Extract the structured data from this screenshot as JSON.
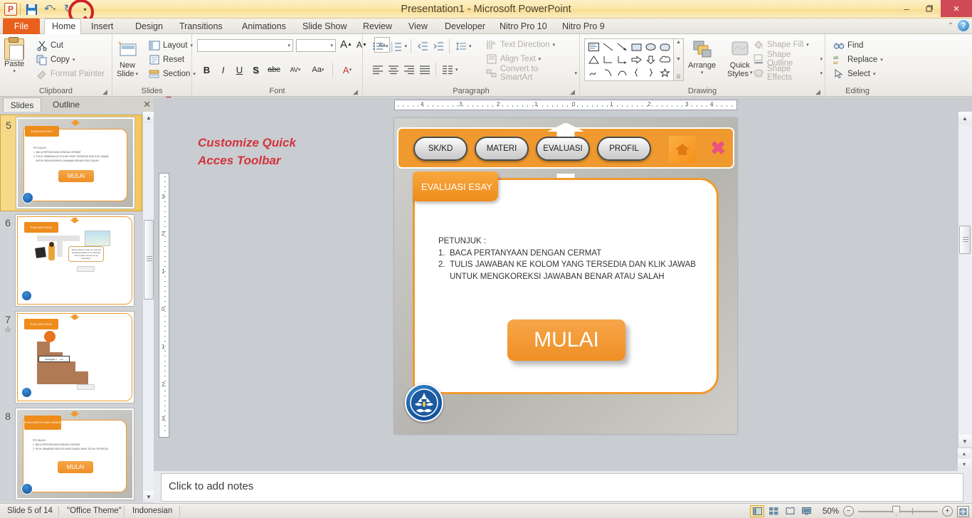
{
  "window": {
    "title": "Presentation1  -  Microsoft PowerPoint",
    "minimize": "–",
    "restore": "❐",
    "close": "×",
    "help": "?",
    "collapse_ribbon": "⌃"
  },
  "qat": {
    "app_icon": "P",
    "save": "save-icon",
    "undo": "↶",
    "redo": "↻",
    "customize": "▾"
  },
  "tabs": [
    {
      "label": "File",
      "state": "file"
    },
    {
      "label": "Home",
      "state": "active"
    },
    {
      "label": "Insert",
      "state": "normal"
    },
    {
      "label": "Design",
      "state": "normal"
    },
    {
      "label": "Transitions",
      "state": "normal"
    },
    {
      "label": "Animations",
      "state": "normal"
    },
    {
      "label": "Slide Show",
      "state": "normal"
    },
    {
      "label": "Review",
      "state": "normal"
    },
    {
      "label": "View",
      "state": "normal"
    },
    {
      "label": "Developer",
      "state": "normal"
    },
    {
      "label": "Nitro Pro 10",
      "state": "normal"
    },
    {
      "label": "Nitro Pro 9",
      "state": "normal"
    }
  ],
  "ribbon": {
    "clipboard": {
      "label": "Clipboard",
      "paste": "Paste",
      "cut": "Cut",
      "copy": "Copy",
      "format_painter": "Format Painter"
    },
    "slides": {
      "label": "Slides",
      "new_slide": "New\nSlide",
      "new_slide_line1": "New",
      "new_slide_line2": "Slide",
      "layout": "Layout",
      "reset": "Reset",
      "section": "Section"
    },
    "font": {
      "label": "Font",
      "font_name": "",
      "font_size": "",
      "grow_font": "A",
      "shrink_font": "A",
      "clear_formatting": "Aa",
      "bold": "B",
      "italic": "I",
      "underline": "U",
      "shadow": "S",
      "strikethrough": "abc",
      "char_spacing": "AV",
      "change_case": "Aa",
      "font_color": "A"
    },
    "paragraph": {
      "label": "Paragraph",
      "text_direction": "Text Direction",
      "align_text": "Align Text",
      "convert_smartart": "Convert to SmartArt"
    },
    "drawing": {
      "label": "Drawing",
      "arrange": "Arrange",
      "quick_styles_line1": "Quick",
      "quick_styles_line2": "Styles",
      "shape_fill": "Shape Fill",
      "shape_outline": "Shape Outline",
      "shape_effects": "Shape Effects"
    },
    "editing": {
      "label": "Editing",
      "find": "Find",
      "replace": "Replace",
      "select": "Select"
    }
  },
  "pane": {
    "tab_slides": "Slides",
    "tab_outline": "Outline",
    "close": "✕",
    "thumbnails": [
      {
        "number": "5",
        "selected": true,
        "kind": "esay",
        "tag": "EVALUASI ESAY",
        "button": "MULAI"
      },
      {
        "number": "6",
        "selected": false,
        "kind": "question",
        "tag": "EVALUASI ESAY",
        "button": "JAWAB"
      },
      {
        "number": "7",
        "selected": false,
        "kind": "stairs",
        "tag": "EVALUASI ESAY",
        "button": "JAWAB",
        "starred": true
      },
      {
        "number": "8",
        "selected": false,
        "kind": "pilgan",
        "tag": "EVALUASI PILIHAN GANDA",
        "button": "MULAI"
      }
    ]
  },
  "annotation": {
    "line1": "Customize Quick",
    "line2": "Acces Toolbar",
    "color": "#d2333c"
  },
  "ruler": {
    "horizontal": [
      "4",
      "3",
      "2",
      "1",
      "0",
      "1",
      "2",
      "3",
      "4"
    ],
    "vertical": [
      "3",
      "2",
      "1",
      "0",
      "1",
      "2",
      "3"
    ]
  },
  "slide": {
    "nav_buttons": [
      "SK/KD",
      "MATERI",
      "EVALUASI",
      "PROFIL"
    ],
    "home_icon": "home-icon",
    "close_icon": "✖",
    "title_tag": "EVALUASI ESAY",
    "instructions_heading": "PETUNJUK  :",
    "instructions": [
      {
        "num": "1.",
        "text": "BACA  PERTANYAAN   DENGAN  CERMAT"
      },
      {
        "num": "2.",
        "text": "TULIS JAWABAN  KE KOLOM YANG  TERSEDIA  DAN  KLIK JAWAB"
      },
      {
        "num": "",
        "text": "UNTUK  MENGKOREKSI  JAWABAN   BENAR  ATAU  SALAH"
      }
    ],
    "start_button": "MULAI",
    "logo": "kemdikbud-logo",
    "accent_color": "#f0992e"
  },
  "notes": {
    "placeholder": "Click to add notes"
  },
  "status": {
    "slide_counter": "Slide 5 of 14",
    "theme": "\"Office Theme\"",
    "language": "Indonesian",
    "zoom": "50%",
    "views": [
      "normal-view",
      "slide-sorter-view",
      "reading-view",
      "slide-show-view"
    ],
    "zoom_out": "−",
    "zoom_in": "+",
    "fit_to_window": "fit-icon"
  }
}
